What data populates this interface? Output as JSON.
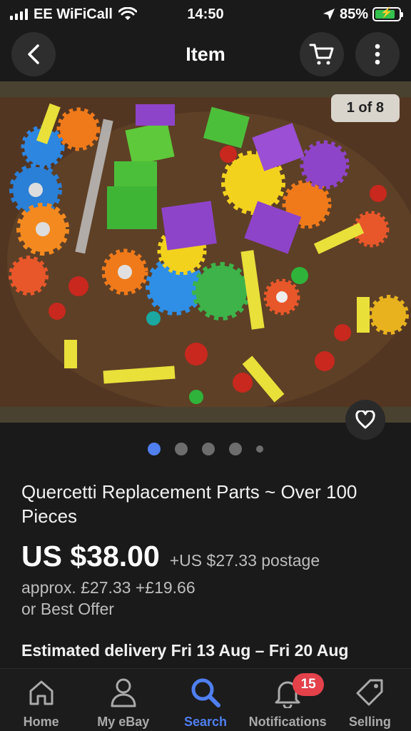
{
  "status_bar": {
    "carrier": "EE WiFiCall",
    "time": "14:50",
    "battery_percent": "85%",
    "battery_level": 0.85
  },
  "nav": {
    "title": "Item",
    "back_icon": "chevron-left-icon",
    "cart_icon": "cart-icon",
    "more_icon": "more-vertical-icon"
  },
  "gallery": {
    "counter": "1 of 8",
    "image_count": 5,
    "active_index": 0,
    "colors": {
      "active_dot": "#4f7ff0",
      "inactive_dot": "#6d6d6d"
    }
  },
  "listing": {
    "title": "Quercetti Replacement Parts ~ Over 100 Pieces",
    "price": "US $38.00",
    "postage": "+US $27.33 postage",
    "approx": "approx. £27.33 +£19.66",
    "offer": "or Best Offer",
    "delivery": "Estimated delivery Fri 13 Aug – Fri 20 Aug"
  },
  "tabs": [
    {
      "label": "Home",
      "icon": "home-icon"
    },
    {
      "label": "My eBay",
      "icon": "user-icon"
    },
    {
      "label": "Search",
      "icon": "search-icon",
      "active": true
    },
    {
      "label": "Notifications",
      "icon": "bell-icon",
      "badge": "15"
    },
    {
      "label": "Selling",
      "icon": "tag-icon"
    }
  ],
  "colors": {
    "accent": "#4f7ff0",
    "badge": "#e4414b",
    "background": "#1a1a1a"
  }
}
